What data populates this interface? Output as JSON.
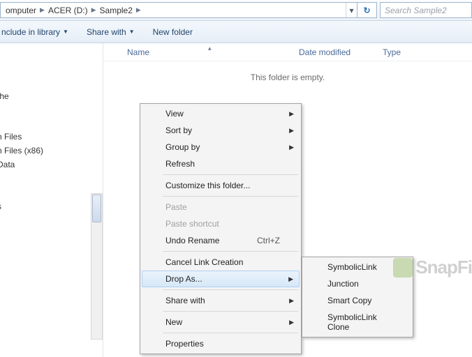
{
  "breadcrumb": {
    "seg0": "omputer",
    "seg1": "ACER (D:)",
    "seg2": "Sample2"
  },
  "search": {
    "placeholder": "Search Sample2"
  },
  "toolbar": {
    "include": "nclude in library",
    "share": "Share with",
    "newfolder": "New folder"
  },
  "sidebar": {
    "i0": "/",
    "i1": ":he",
    "i2": ":",
    "i3": "n Files",
    "i4": "n Files (x86)",
    "i5": "Data",
    "i6": "s",
    "i7": "/"
  },
  "columns": {
    "name": "Name",
    "date": "Date modified",
    "type": "Type"
  },
  "empty": "This folder is empty.",
  "menu": {
    "view": "View",
    "sortby": "Sort by",
    "groupby": "Group by",
    "refresh": "Refresh",
    "customize": "Customize this folder...",
    "paste": "Paste",
    "pasteshortcut": "Paste shortcut",
    "undo": "Undo Rename",
    "undo_key": "Ctrl+Z",
    "cancel": "Cancel Link Creation",
    "dropas": "Drop As...",
    "sharewith": "Share with",
    "new": "New",
    "properties": "Properties"
  },
  "submenu": {
    "sym": "SymbolicLink",
    "junc": "Junction",
    "smart": "Smart Copy",
    "symclone": "SymbolicLink Clone"
  },
  "watermark": {
    "text": "SnapFi"
  }
}
